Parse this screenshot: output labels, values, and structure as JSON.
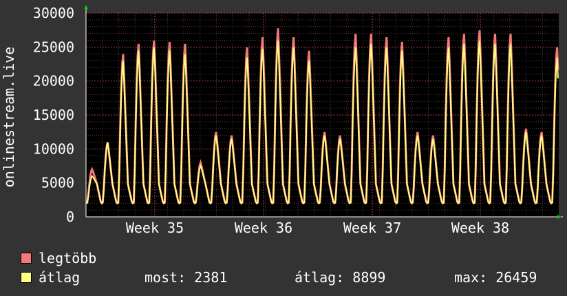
{
  "chart_data": {
    "type": "area",
    "ylabel": "onlinestream.live",
    "ylim": [
      0,
      30000
    ],
    "y_ticks": [
      "0",
      "5000",
      "10000",
      "15000",
      "20000",
      "25000",
      "30000"
    ],
    "x_ticks": [
      "Week 35",
      "Week 36",
      "Week 37",
      "Week 38"
    ],
    "grid": true,
    "x_days": 29,
    "series": [
      {
        "name": "legtöbb",
        "color": "#f47a7a",
        "daily_peaks": [
          7000,
          11000,
          24000,
          25500,
          26000,
          25800,
          25500,
          8000,
          12500,
          12000,
          25000,
          26500,
          27800,
          26500,
          24500,
          12500,
          12000,
          27000,
          27000,
          26500,
          25800,
          12500,
          12000,
          26500,
          27000,
          27500,
          27000,
          27000,
          13000,
          12500,
          25000
        ]
      },
      {
        "name": "átlag",
        "color": "#ffff80",
        "daily_peaks": [
          6000,
          11000,
          23000,
          24500,
          25000,
          24500,
          24000,
          7500,
          12000,
          11500,
          23500,
          24800,
          26000,
          25000,
          23000,
          12000,
          11500,
          25000,
          25500,
          25000,
          24500,
          12000,
          11500,
          25000,
          25500,
          26000,
          25500,
          25500,
          12500,
          12000,
          23500
        ]
      }
    ]
  },
  "legend": {
    "max_label": "legtöbb",
    "avg_label": "átlag",
    "max_color": "#f47a7a",
    "avg_color": "#ffff80"
  },
  "stats": {
    "current": "most: 2381",
    "average": "átlag: 8899",
    "max": "max: 26459"
  }
}
